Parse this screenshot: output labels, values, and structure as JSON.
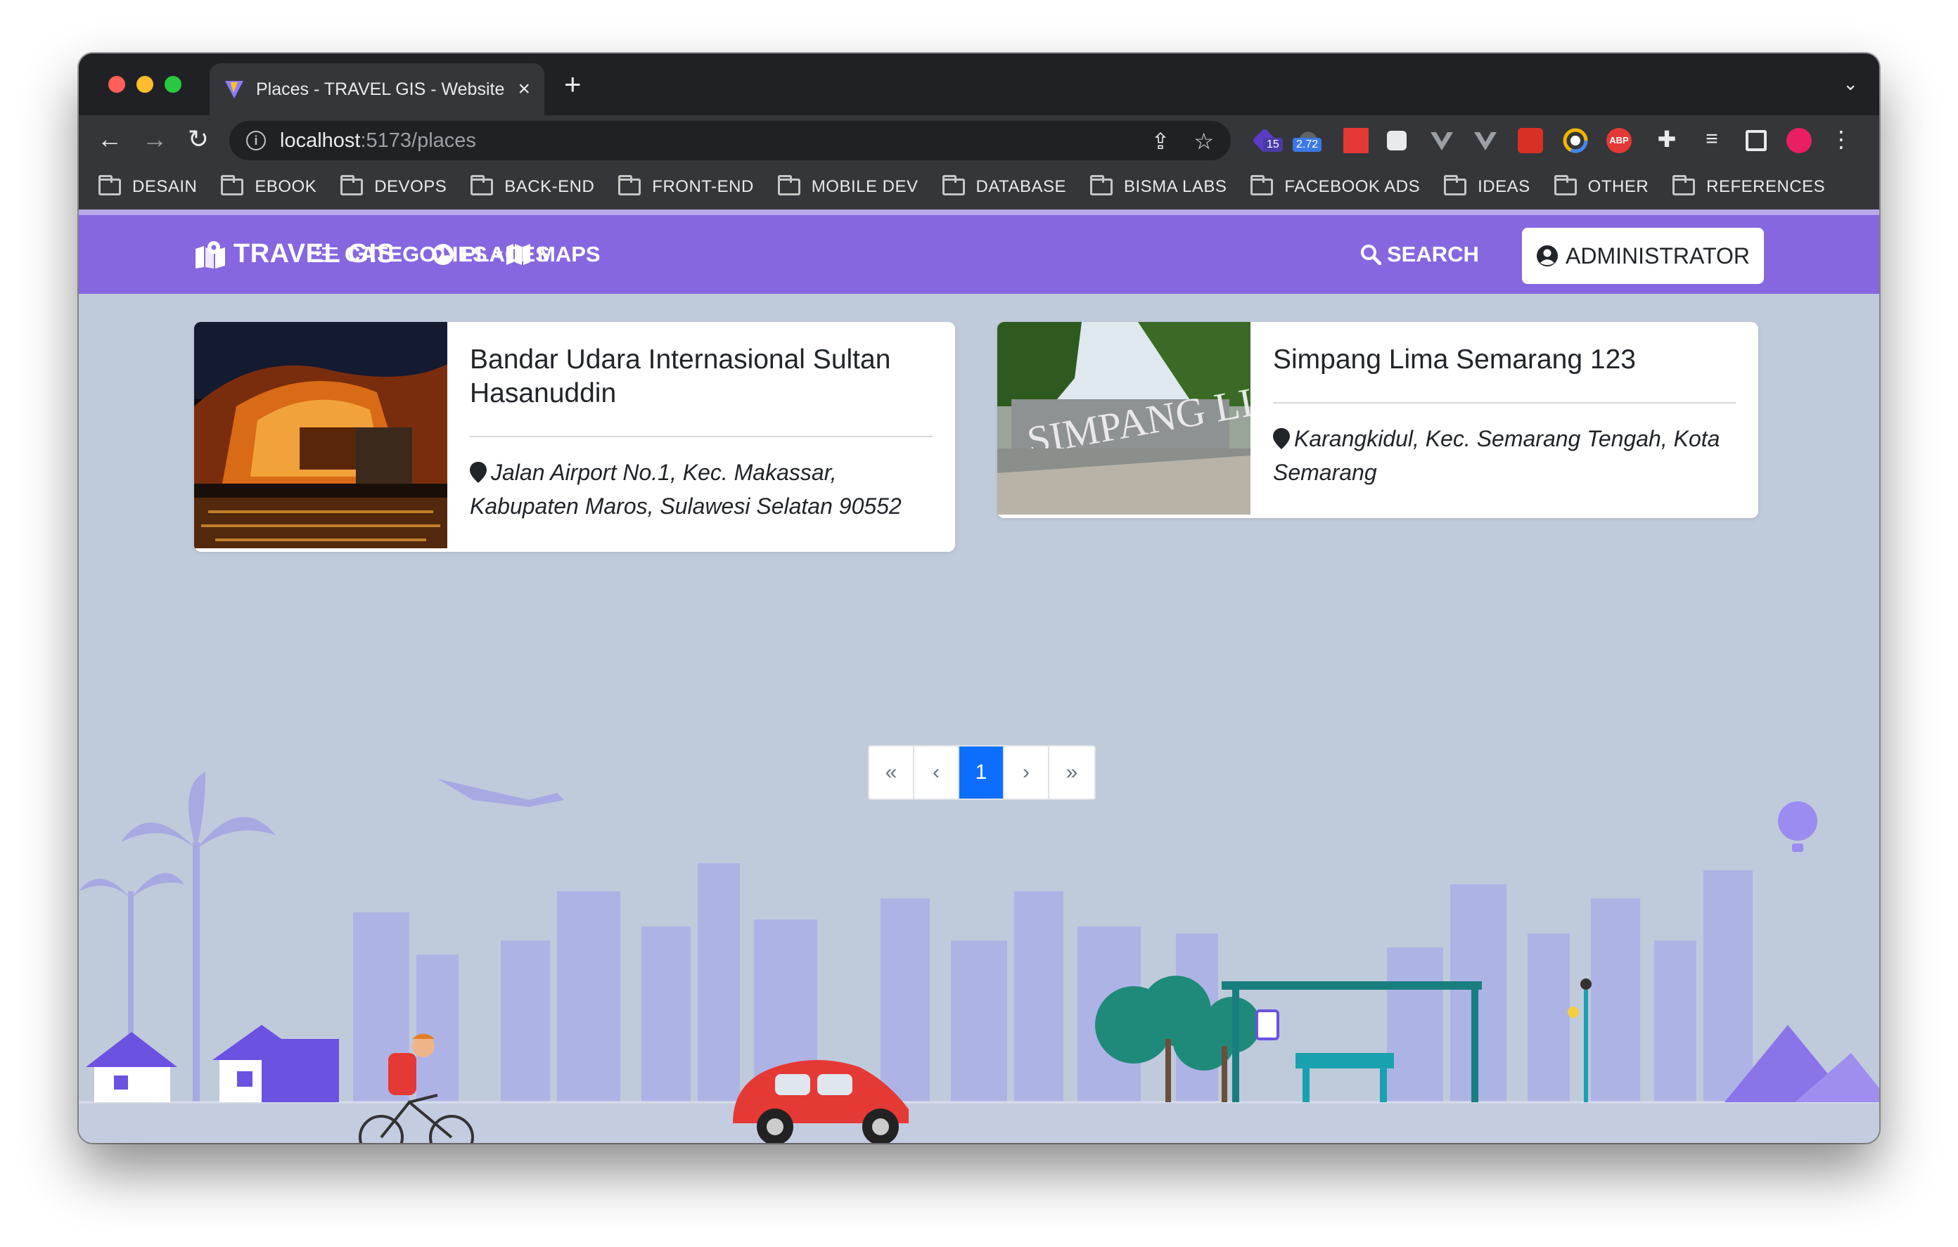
{
  "browser": {
    "tab_title": "Places - TRAVEL GIS - Website",
    "url_host": "localhost",
    "url_path": ":5173/places",
    "ext_badge_1": "15",
    "ext_badge_2": "2.72",
    "ext_abp": "ABP",
    "bookmarks": [
      "DESAIN",
      "EBOOK",
      "DEVOPS",
      "BACK-END",
      "FRONT-END",
      "MOBILE DEV",
      "DATABASE",
      "BISMA LABS",
      "FACEBOOK ADS",
      "IDEAS",
      "OTHER",
      "REFERENCES"
    ]
  },
  "navbar": {
    "brand": "TRAVEL GIS",
    "categories": "CATEGORIES",
    "places": "PLACES",
    "maps": "MAPS",
    "search": "SEARCH",
    "admin": "ADMINISTRATOR",
    "brand_color": "#8667e0"
  },
  "places": [
    {
      "title": "Bandar Udara Internasional Sultan Hasanuddin",
      "address": "Jalan Airport No.1, Kec. Makassar, Kabupaten Maros, Sulawesi Selatan 90552"
    },
    {
      "title": "Simpang Lima Semarang 123",
      "address": "Karangkidul, Kec. Semarang Tengah, Kota Semarang"
    }
  ],
  "pagination": {
    "first": "«",
    "prev": "‹",
    "current": "1",
    "next": "›",
    "last": "»"
  }
}
